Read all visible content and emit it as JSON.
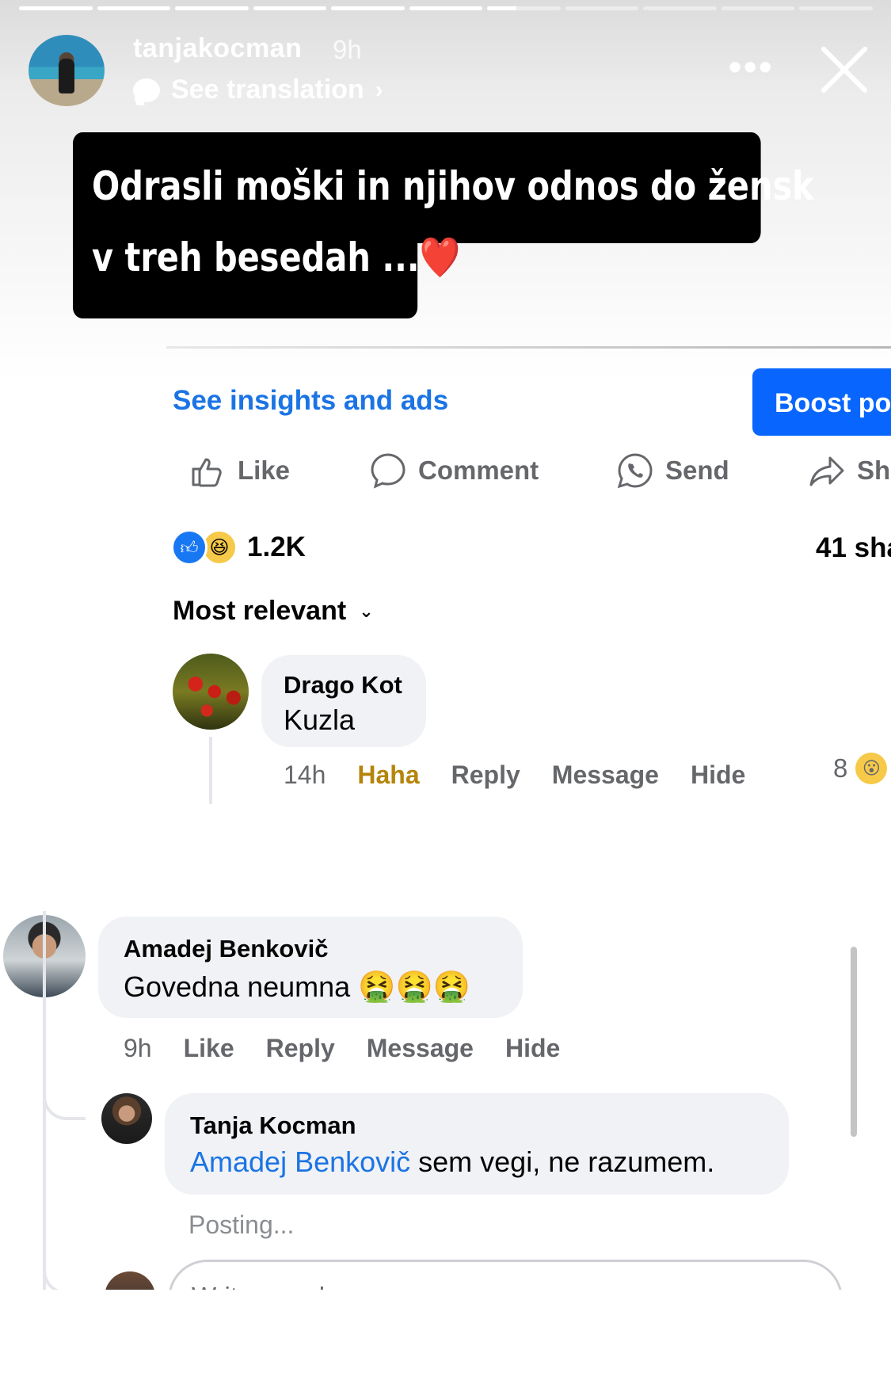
{
  "story": {
    "username": "tanjakocman",
    "time": "9h",
    "translation_label": "See translation",
    "more_label": "•••",
    "progress_segments": [
      1,
      1,
      1,
      1,
      1,
      1,
      0.4,
      0,
      0,
      0,
      0
    ]
  },
  "caption": {
    "line1": "Odrasli moški in njihov odnos do žensk",
    "line2": "v treh besedah ...",
    "emoji": "❤️"
  },
  "post": {
    "insights_label": "See insights and ads",
    "boost_label": "Boost po",
    "actions": {
      "like": "Like",
      "comment": "Comment",
      "send": "Send",
      "share": "Sh"
    },
    "reaction_count": "1.2K",
    "shares": "41 sha",
    "sort_label": "Most relevant"
  },
  "comments": [
    {
      "author": "Drago Kot",
      "text": "Kuzla",
      "time": "14h",
      "reaction": "Haha",
      "reply": "Reply",
      "message": "Message",
      "hide": "Hide",
      "reaction_count": "8"
    },
    {
      "author": "Amadej Benkovič",
      "text": "Govedna neumna",
      "emojis": "🤮🤮🤮",
      "time": "9h",
      "like": "Like",
      "reply": "Reply",
      "message": "Message",
      "hide": "Hide"
    }
  ],
  "reply": {
    "author": "Tanja Kocman",
    "mention": "Amadej Benkovič",
    "text": " sem vegi, ne razumem.",
    "status": "Posting..."
  },
  "composer": {
    "placeholder": "Write a reply..."
  }
}
